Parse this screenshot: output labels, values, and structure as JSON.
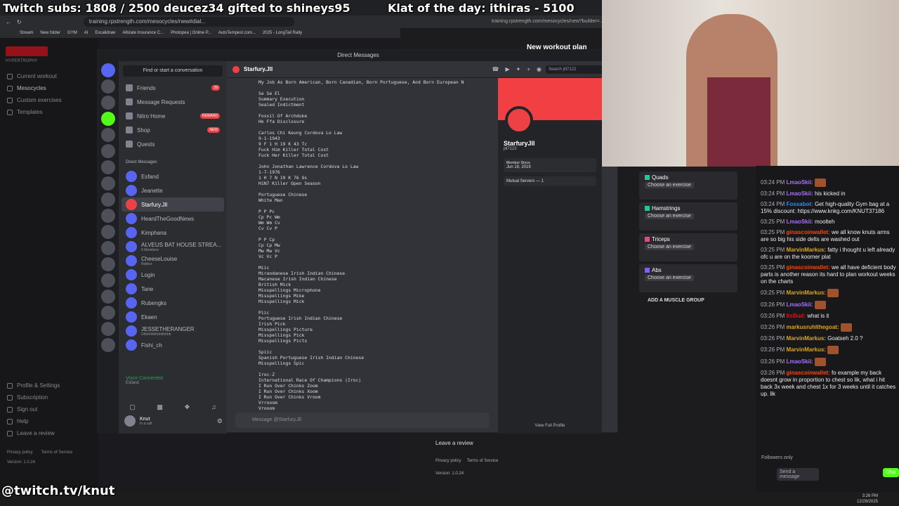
{
  "overlay": {
    "subs": "Twitch subs: 1808 / 2500  deucez34 gifted to shineys95",
    "klat": "Klat of the day: ithiras - 5100",
    "handle": "@twitch.tv/knut"
  },
  "left_browser": {
    "url": "training.rpstrength.com/mesocycles/new#dial...",
    "bookmarks": [
      "Stream",
      "New folder",
      "GYM",
      "AI",
      "Excalidraw",
      "Allstate Insurance C...",
      "Photopea | Online P...",
      "AutoTempest.com...",
      "2025 - LongTail Rally"
    ],
    "brand": "HYPERTROPHY",
    "nav": [
      "Current workout",
      "Mesocycles",
      "Custom exercises",
      "Templates"
    ],
    "bottom_nav": [
      "Profile & Settings",
      "Subscription",
      "Sign out",
      "Help",
      "Leave a review"
    ],
    "footer": {
      "privacy": "Privacy policy",
      "terms": "Terms of Service",
      "version": "Version: 1.0.24"
    }
  },
  "right_browser": {
    "url": "training.rpstrength.com/mesocycles/new?builder=...",
    "title": "New workout plan",
    "exercises": [
      {
        "group": "Quads",
        "btn": "Choose an exercise"
      },
      {
        "group": "Hamstrings",
        "btn": "Choose an exercise"
      },
      {
        "group": "Triceps",
        "btn": "Choose an exercise"
      },
      {
        "group": "Abs",
        "btn": "Choose an exercise"
      }
    ],
    "add_group": "ADD A MUSCLE GROUP",
    "leave_review": "Leave a review",
    "privacy": "Privacy policy",
    "terms": "Terms of Service",
    "version": "Version: 1.0.24"
  },
  "discord": {
    "window_title": "Direct Messages",
    "search": "Find or start a conversation",
    "channel_title": "Starfury.Jll",
    "search_box": "Search jill7122",
    "menu": [
      {
        "label": "Friends",
        "badge": "29"
      },
      {
        "label": "Message Requests",
        "badge": ""
      },
      {
        "label": "Nitro Home",
        "badge": "REWARD"
      },
      {
        "label": "Shop",
        "badge": "NEW"
      },
      {
        "label": "Quests",
        "badge": ""
      }
    ],
    "dm_header": "Direct Messages",
    "dms": [
      {
        "name": "Esfand",
        "sub": ""
      },
      {
        "name": "Jeanette",
        "sub": ""
      },
      {
        "name": "Starfury.Jll",
        "sub": ""
      },
      {
        "name": "HeardTheGoodNews",
        "sub": ""
      },
      {
        "name": "Kimphana",
        "sub": ""
      },
      {
        "name": "ALVEUS BAT HOUSE STREA...",
        "sub": "8 Members"
      },
      {
        "name": "CheeseLouise",
        "sub": "Roblox"
      },
      {
        "name": "Login",
        "sub": ""
      },
      {
        "name": "Tane",
        "sub": ""
      },
      {
        "name": "Rubengks",
        "sub": ""
      },
      {
        "name": "Ekaen",
        "sub": ""
      },
      {
        "name": "JESSETHERANGER",
        "sub": "Uhhhhhhhhhhhhhh"
      },
      {
        "name": "Fishi_ch",
        "sub": ""
      }
    ],
    "voice": {
      "status": "Voice Connected",
      "channel": "Esfand"
    },
    "user": {
      "name": "Knut",
      "status": "In a call"
    },
    "input_placeholder": "Message @Starfury.Jll",
    "message": "My Job As Born American, Born Canadian, Born Portuguese, And Born European N\n\nSe Se El\nSummary Execution\nSealed Indictment\n\nFossil Of Archduke\nHk Ffa Disclosure\n\nCarlos Chi Keung Cordova Lo Law\n9-1-1943\n9 F 1 H 19 K 43 Tc\nFuck Him Killer Total Cost\nFuck Her Killer Total Cost\n\nJohn Jonathan Lawrence Cordova Lo Law\n1-7-1976\n1 H 7 N 19 K 76 Os\nH1N7 Killer Open Season\n\nPortuguese Chinese\nWhite Man\n\nP P Pc\nCp Pc Wm\nWm Wm Cv\nCv Cv P\n\nP P Cp\nCp Cp Mw\nMw Mw Vc\nVc Vc P\n\nMiic\nMirandanese Irish Indian Chinese\nMacanese Irish Indian Chinese\nBritish Mick\nMisspellings Microphone\nMisspellings Mike\nMisspellings Mick\n\nPiic\nPortuguese Irish Indian Chinese\nIrish Pick\nMisspellings Picture\nMisspellings Pick\nMisspellings Picts\n\nSpiic\nSpanish Portuguese Irish Indian Chinese\nMisspellings Spic\n\nIroc-Z\nInternational Race Of Champions (Iroc)\nI Run Over Chinks Zoom\nI Run Over Chinks Xoom\nI Run Over Chinks Vroom\nVrrooom\nVrooom",
    "profile": {
      "name": "StarfuryJll",
      "tag": "jill7122",
      "member_since_label": "Member Since",
      "member_since": "Jun 19, 2019",
      "mutual": "Mutual Servers — 1",
      "view": "View Full Profile"
    }
  },
  "chat": {
    "messages": [
      {
        "t": "03:24 PM",
        "u": "LmaoSkii:",
        "c": "#a970ff",
        "text": ""
      },
      {
        "t": "03:24 PM",
        "u": "LmaoSkii:",
        "c": "#a970ff",
        "text": "his kicked in"
      },
      {
        "t": "03:24 PM",
        "u": "Fossabot:",
        "c": "#1e90ff",
        "text": "Get high-quality Gym bag at a 15% discount: https://www.knkg.com/KNUT37186"
      },
      {
        "t": "03:25 PM",
        "u": "LmaoSkii:",
        "c": "#a970ff",
        "text": "moolteh"
      },
      {
        "t": "03:25 PM",
        "u": "ginascoinwallet:",
        "c": "#ff4500",
        "text": "we all know knuts arms are so big his side delts are washed out"
      },
      {
        "t": "03:25 PM",
        "u": "MarvinMarkus:",
        "c": "#daa520",
        "text": "fatty i thought u left already ofc u are on the koomer plat"
      },
      {
        "t": "03:25 PM",
        "u": "ginascoinwallet:",
        "c": "#ff4500",
        "text": "we all have deficient body parts is another reason its hard to plan workout weeks on the charts"
      },
      {
        "t": "03:25 PM",
        "u": "MarvinMarkus:",
        "c": "#daa520",
        "text": ""
      },
      {
        "t": "03:26 PM",
        "u": "LmaoSkii:",
        "c": "#a970ff",
        "text": ""
      },
      {
        "t": "03:26 PM",
        "u": "ItsBud:",
        "c": "#ff0000",
        "text": "what is it"
      },
      {
        "t": "03:26 PM",
        "u": "markusruhlthegoat:",
        "c": "#daa520",
        "text": ""
      },
      {
        "t": "03:26 PM",
        "u": "MarvinMarkus:",
        "c": "#daa520",
        "text": "Goatseh 2.0 ?"
      },
      {
        "t": "03:26 PM",
        "u": "MarvinMarkus:",
        "c": "#daa520",
        "text": ""
      },
      {
        "t": "03:26 PM",
        "u": "LmaoSkii:",
        "c": "#a970ff",
        "text": ""
      },
      {
        "t": "03:26 PM",
        "u": "ginascoinwallet:",
        "c": "#ff4500",
        "text": "fo example my back doesnt grow in proportion to chest so lik, what i hit back 3x week and chest 1x for 3 weeks until it catches up. lik"
      }
    ],
    "followers": "Followers only",
    "send": "Send a message",
    "chat_btn": "Chat"
  },
  "taskbar": {
    "time": "3:26 PM",
    "date": "12/29/2025"
  }
}
